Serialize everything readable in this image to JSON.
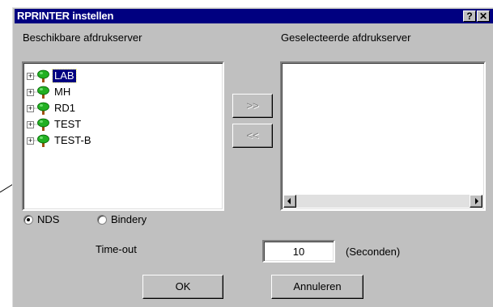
{
  "window": {
    "title": "RPRINTER instellen",
    "help_button": "?",
    "close_button": "✕"
  },
  "left_panel": {
    "heading": "Beschikbare afdrukserver",
    "tree": [
      {
        "label": "LAB",
        "selected": true,
        "icon": "tree-icon",
        "expander": "+"
      },
      {
        "label": "MH",
        "selected": false,
        "icon": "tree-icon",
        "expander": "+"
      },
      {
        "label": "RD1",
        "selected": false,
        "icon": "tree-icon",
        "expander": "+"
      },
      {
        "label": "TEST",
        "selected": false,
        "icon": "tree-icon",
        "expander": "+"
      },
      {
        "label": "TEST-B",
        "selected": false,
        "icon": "tree-icon",
        "expander": "+"
      }
    ]
  },
  "right_panel": {
    "heading": "Geselecteerde afdrukserver"
  },
  "transfer": {
    "add_label": ">>",
    "remove_label": "<<"
  },
  "mode": {
    "nds_label": "NDS",
    "nds_checked": true,
    "bindery_label": "Bindery",
    "bindery_checked": false
  },
  "timeout": {
    "label": "Time-out",
    "value": "10",
    "unit": "(Seconden)"
  },
  "actions": {
    "ok_label": "OK",
    "cancel_label": "Annuleren"
  },
  "colors": {
    "dialog": "#c0c0c0",
    "titlebar": "#000080",
    "selection": "#000080",
    "tree_canopy": "#22b022",
    "tree_trunk": "#a05010"
  }
}
